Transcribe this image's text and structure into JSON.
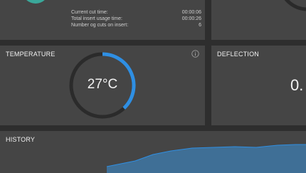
{
  "top_left": {
    "stats": [
      {
        "label": "Current cut time:",
        "value": "00:00:06"
      },
      {
        "label": "Total insert usage time:",
        "value": "00:00:26"
      },
      {
        "label": "Number og cuts on insert:",
        "value": "6"
      }
    ]
  },
  "temperature": {
    "title": "TEMPERATURE",
    "value": "27°C",
    "gauge_fraction": 0.38,
    "info_icon": "info-icon",
    "accent_color": "#2f8fe3"
  },
  "deflection": {
    "title": "DEFLECTION",
    "value": "0."
  },
  "history": {
    "title": "HISTORY",
    "fill_color": "#3f6f96",
    "line_color": "#2f8fe3"
  }
}
